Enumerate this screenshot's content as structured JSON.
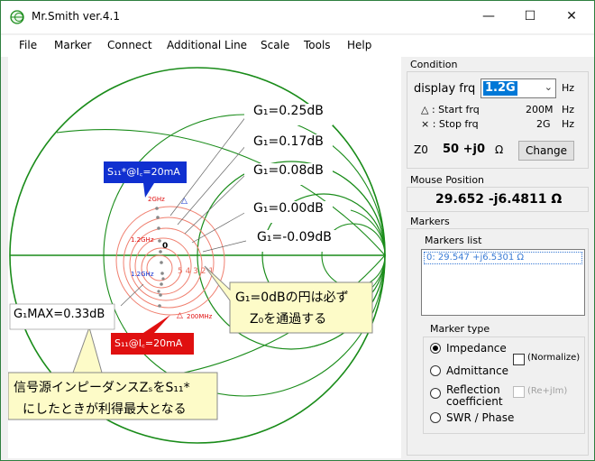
{
  "window": {
    "title": "Mr.Smith ver.4.1",
    "minimize": "—",
    "maximize": "☐",
    "close": "✕"
  },
  "menu": [
    "File",
    "Marker",
    "Connect",
    "Additional Line",
    "Scale",
    "Tools",
    "Help"
  ],
  "condition": {
    "group_label": "Condition",
    "display_frq_label": "display frq",
    "display_frq_value": "1.2G",
    "hz1": "Hz",
    "start_label": "△ : Start frq",
    "start_value": "200M",
    "hz2": "Hz",
    "stop_label": "× : Stop frq",
    "stop_value": "2G",
    "hz3": "Hz",
    "z0_label": "Z0",
    "z0_value": "50 +j0",
    "z0_unit": "Ω",
    "change_button": "Change"
  },
  "mouse_position": {
    "group_label": "Mouse Position",
    "value": "29.652  -j6.4811 Ω"
  },
  "markers": {
    "group_label": "Markers",
    "list_label": "Markers list",
    "items": [
      "0: 29.547 +j6.5301 Ω"
    ]
  },
  "marker_type": {
    "group_label": "Marker type",
    "options": [
      "Impedance",
      "Admittance",
      "Reflection",
      "SWR / Phase"
    ],
    "reflection_line2": "coefficient",
    "selected": "Impedance",
    "normalize_label": "(Normalize)",
    "reim_label": "(Re+jIm)"
  },
  "chart": {
    "labels_gain": [
      "G₁=0.25dB",
      "G₁=0.17dB",
      "G₁=0.08dB",
      "G₁=0.00dB",
      "G₁=-0.09dB"
    ],
    "g1max_label": "G₁MAX=0.33dB",
    "s11star_label": "S₁₁*@I꜀=20mA",
    "s11_label": "S₁₁@I꜀=20mA",
    "freq_2ghz": "2GHz",
    "freq_12ghz_red": "1.2GHz",
    "freq_12ghz_blue": "1.2GHz",
    "freq_200mhz": "200MHz",
    "marker_zero": "0",
    "circle_numbers": "5 4 3 2 1",
    "callout_z0_line1": "G₁=0dBの円は必ず",
    "callout_z0_line2": "Z₀を通過する",
    "callout_source_line1": "信号源インピーダンスZₛをS₁₁*",
    "callout_source_line2": "にしたときが利得最大となる",
    "colors": {
      "smith_green": "#1a8c1a",
      "circle_red": "#e86a5a",
      "blue_box": "#1030d0",
      "red_box": "#e01010",
      "callout_bg": "#fdfbc8"
    }
  }
}
